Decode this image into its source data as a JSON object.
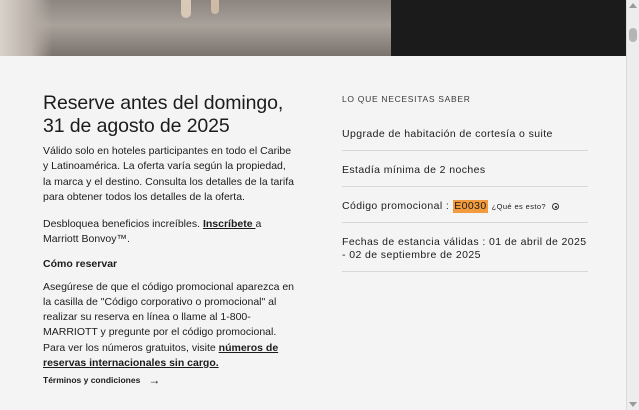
{
  "hero": {
    "image": "hotel-interior-photo"
  },
  "offer": {
    "title_line1": "Reserve antes del domingo,",
    "title_line2": "31 de agosto de 2025",
    "description": "Válido solo en hoteles participantes en todo el Caribe y Latinoamérica. La oferta varía según la propiedad, la marca y el destino. Consulta los detalles de la tarifa para obtener todos los detalles de la oferta.",
    "unlock_text": "Desbloquea beneficios increíbles. ",
    "unlock_link": "Inscríbete ",
    "unlock_suffix": "a Marriott Bonvoy™.",
    "how_title": "Cómo reservar",
    "how_text": "Asegúrese de que el código promocional aparezca en la casilla de \"Código corporativo o promocional\" al realizar su reserva en línea o llame al 1-800-MARRIOTT y pregunte por el código promocional. Para ver los números gratuitos, visite ",
    "how_link": "números de reservas internacionales sin cargo.",
    "terms_label": "Términos y condiciones",
    "terms_icon": "arrow-right-icon"
  },
  "details": {
    "kicker": "LO QUE NECESITAS SABER",
    "item1": "Upgrade de habitación de cortesía o suite",
    "item2": "Estadía mínima de 2 noches",
    "code_label": "Código promocional :",
    "code_value": "E0030",
    "code_help": "¿Qué es esto?",
    "dates": "Fechas de estancia válidas : 01 de abril de 2025 - 02 de septiembre de 2025"
  },
  "colors": {
    "highlight": "#f19a3e",
    "text": "#1c1c1c",
    "background": "#f4f4f4"
  }
}
